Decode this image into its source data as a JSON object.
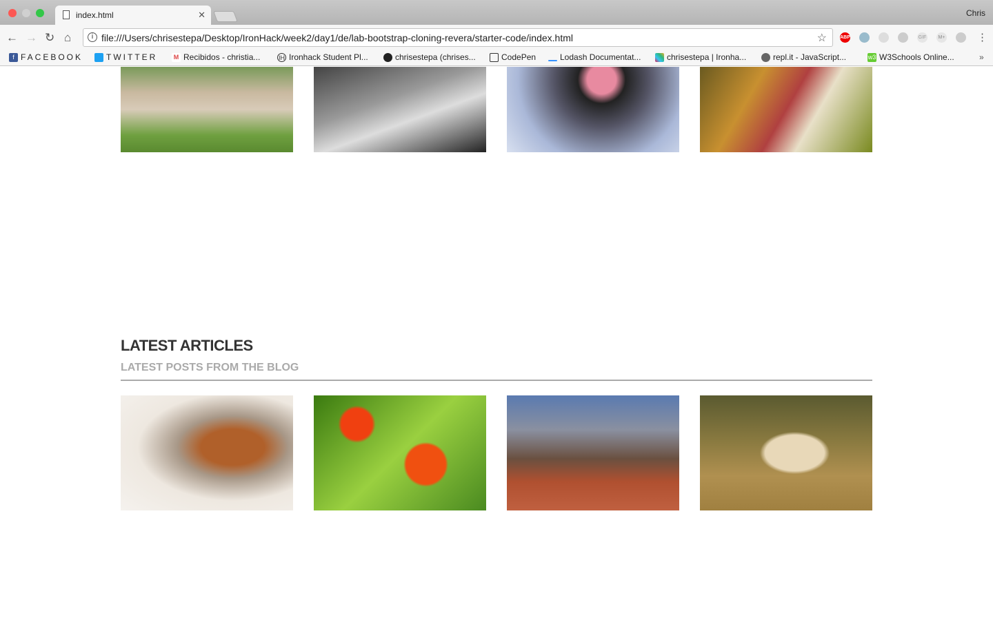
{
  "browser": {
    "tab_title": "index.html",
    "user": "Chris",
    "url": "file:///Users/chrisestepa/Desktop/IronHack/week2/day1/de/lab-bootstrap-cloning-revera/starter-code/index.html",
    "extensions": [
      "adblock-icon",
      "download-icon",
      "extension-icon",
      "dropbox-icon",
      "gif-icon",
      "m-icon",
      "drive-icon"
    ],
    "bookmarks": [
      {
        "label": "FACEBOOK",
        "icon": "facebook-icon"
      },
      {
        "label": "TWITTER",
        "icon": "twitter-icon"
      },
      {
        "label": "Recibidos - christia...",
        "icon": "gmail-icon"
      },
      {
        "label": "Ironhack Student Pl...",
        "icon": "ironhack-icon"
      },
      {
        "label": "chrisestepa (chrises...",
        "icon": "github-icon"
      },
      {
        "label": "CodePen",
        "icon": "codepen-icon"
      },
      {
        "label": "Lodash Documentat...",
        "icon": "lodash-icon"
      },
      {
        "label": "chrisestepa | Ironha...",
        "icon": "slack-icon"
      },
      {
        "label": "repl.it - JavaScript...",
        "icon": "replit-icon"
      },
      {
        "label": "W3Schools Online...",
        "icon": "w3schools-icon"
      }
    ]
  },
  "page": {
    "articles_title": "LATEST ARTICLES",
    "articles_subtitle": "LATEST POSTS FROM THE BLOG"
  }
}
